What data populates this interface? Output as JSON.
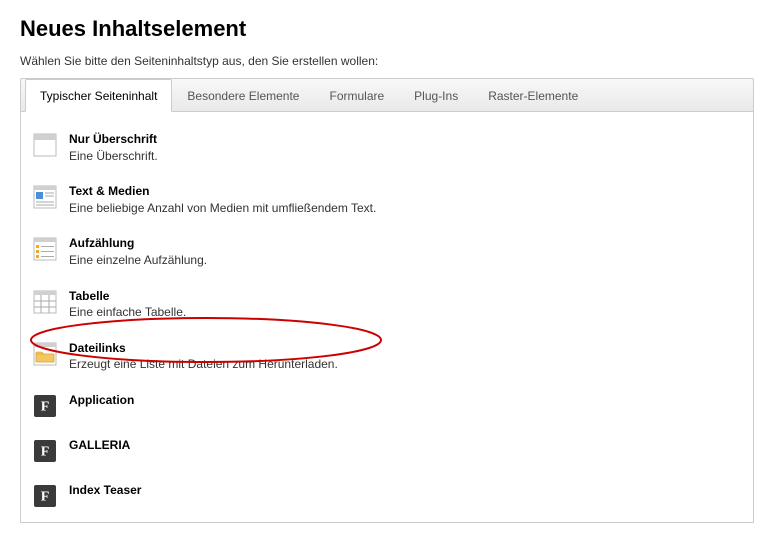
{
  "heading": "Neues Inhaltselement",
  "intro": "Wählen Sie bitte den Seiteninhaltstyp aus, den Sie erstellen wollen:",
  "tabs": [
    {
      "label": "Typischer Seiteninhalt",
      "active": true
    },
    {
      "label": "Besondere Elemente",
      "active": false
    },
    {
      "label": "Formulare",
      "active": false
    },
    {
      "label": "Plug-Ins",
      "active": false
    },
    {
      "label": "Raster-Elemente",
      "active": false
    }
  ],
  "items": [
    {
      "title": "Nur Überschrift",
      "desc": "Eine Überschrift."
    },
    {
      "title": "Text & Medien",
      "desc": "Eine beliebige Anzahl von Medien mit umfließendem Text."
    },
    {
      "title": "Aufzählung",
      "desc": "Eine einzelne Aufzählung."
    },
    {
      "title": "Tabelle",
      "desc": "Eine einfache Tabelle."
    },
    {
      "title": "Dateilinks",
      "desc": "Erzeugt eine Liste mit Dateien zum Herunterladen."
    },
    {
      "title": "Application",
      "desc": ""
    },
    {
      "title": "GALLERIA",
      "desc": ""
    },
    {
      "title": "Index Teaser",
      "desc": ""
    }
  ],
  "annotation": {
    "highlight_item_index": 4,
    "color": "#cc0000"
  }
}
